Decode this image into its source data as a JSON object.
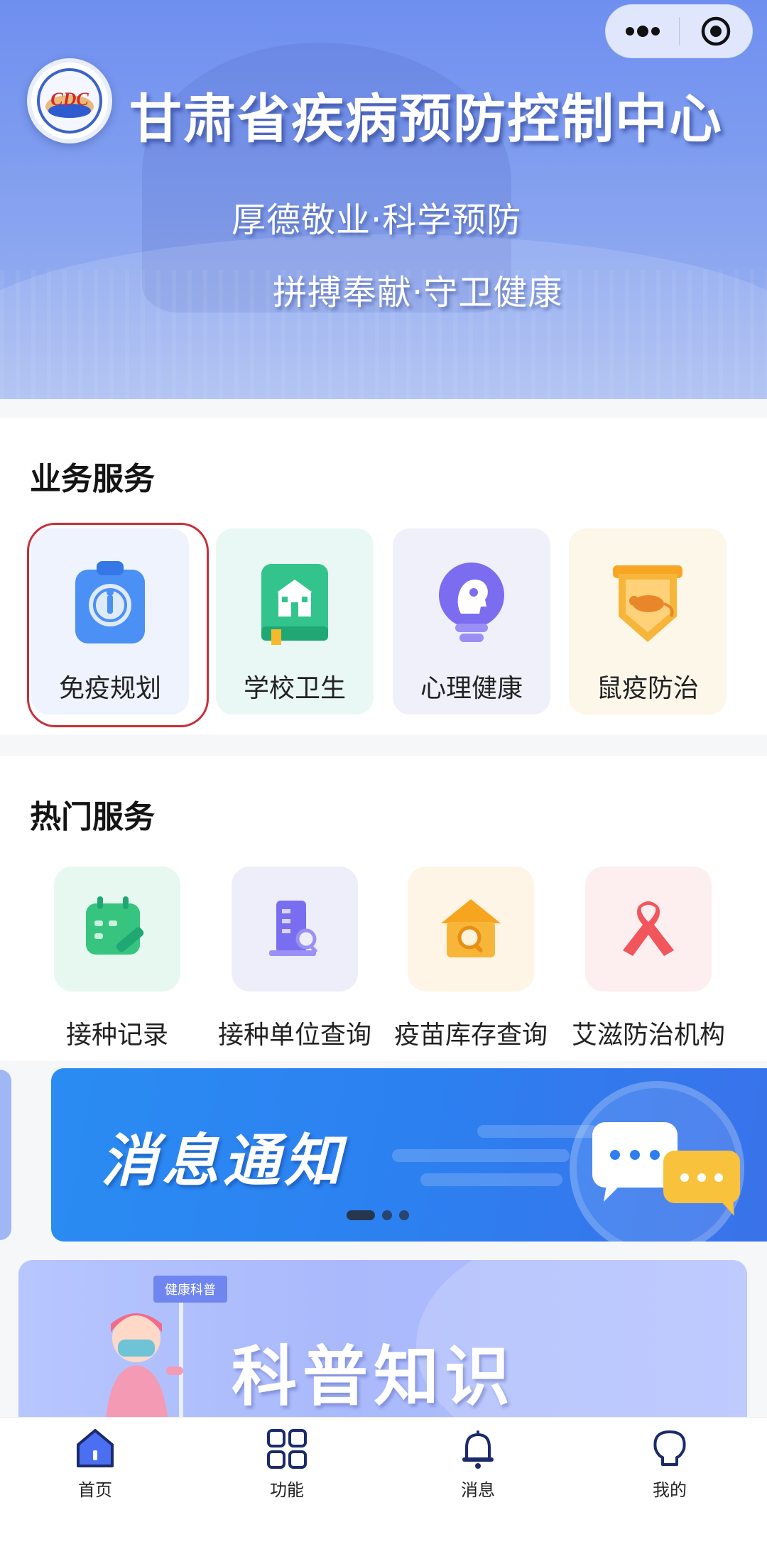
{
  "header": {
    "logo_text": "CDC",
    "org_name": "甘肃省疾病预防控制中心",
    "slogan_line1": "厚德敬业·科学预防",
    "slogan_line2": "拼搏奉献·守卫健康"
  },
  "capsule": {
    "more_icon": "more-dots-icon",
    "close_icon": "target-circle-icon"
  },
  "business": {
    "title": "业务服务",
    "items": [
      {
        "label": "免疫规划",
        "icon": "clipboard-icon",
        "color": "#4a90f5"
      },
      {
        "label": "学校卫生",
        "icon": "school-book-icon",
        "color": "#33c48d"
      },
      {
        "label": "心理健康",
        "icon": "head-bulb-icon",
        "color": "#7b6cf0"
      },
      {
        "label": "鼠疫防治",
        "icon": "rat-shield-icon",
        "color": "#f6a623"
      }
    ]
  },
  "hot": {
    "title": "热门服务",
    "items": [
      {
        "label": "接种记录",
        "icon": "calendar-syringe-icon",
        "color": "#36c47f"
      },
      {
        "label": "接种单位查询",
        "icon": "building-search-icon",
        "color": "#7a6ef0"
      },
      {
        "label": "疫苗库存查询",
        "icon": "house-search-icon",
        "color": "#f7a51f"
      },
      {
        "label": "艾滋防治机构",
        "icon": "red-ribbon-icon",
        "color": "#f0565c"
      }
    ]
  },
  "carousel": {
    "notice_title": "消息通知",
    "slide_count": 3,
    "active_slide": 1
  },
  "science": {
    "sign": "健康科普",
    "title": "科普知识"
  },
  "tabbar": {
    "items": [
      {
        "label": "首页",
        "icon": "home-icon",
        "active": true
      },
      {
        "label": "功能",
        "icon": "grid-icon",
        "active": false
      },
      {
        "label": "消息",
        "icon": "bell-icon",
        "active": false
      },
      {
        "label": "我的",
        "icon": "user-icon",
        "active": false
      }
    ],
    "accent": "#2d4fd6"
  }
}
